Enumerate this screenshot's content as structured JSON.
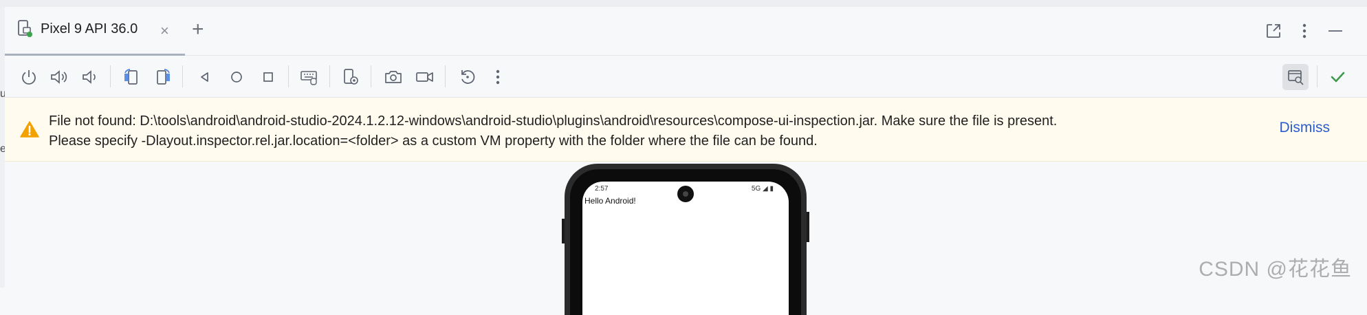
{
  "tab": {
    "title": "Pixel 9 API 36.0",
    "close_glyph": "×",
    "add_glyph": "+"
  },
  "window_controls": [
    "open-in-new-window-icon",
    "more-vertical-icon",
    "minimize-icon"
  ],
  "toolbar": {
    "buttons": [
      {
        "name": "power-icon",
        "tooltip": "Power"
      },
      {
        "name": "volume-up-icon",
        "tooltip": "Volume Up"
      },
      {
        "name": "volume-down-icon",
        "tooltip": "Volume Down"
      },
      {
        "name": "rotate-left-icon",
        "tooltip": "Rotate Left"
      },
      {
        "name": "rotate-right-icon",
        "tooltip": "Rotate Right"
      },
      {
        "name": "back-icon",
        "tooltip": "Back"
      },
      {
        "name": "home-icon",
        "tooltip": "Home"
      },
      {
        "name": "overview-icon",
        "tooltip": "Overview"
      },
      {
        "name": "keyboard-icon",
        "tooltip": "Keyboard"
      },
      {
        "name": "device-settings-icon",
        "tooltip": "Device Settings"
      },
      {
        "name": "camera-icon",
        "tooltip": "Take Screenshot"
      },
      {
        "name": "record-video-icon",
        "tooltip": "Record Screen"
      },
      {
        "name": "reset-icon",
        "tooltip": "Reset"
      },
      {
        "name": "more-vertical-icon",
        "tooltip": "More"
      },
      {
        "name": "layout-inspector-icon",
        "tooltip": "Layout Inspector"
      },
      {
        "name": "checkmark-icon",
        "tooltip": "Done"
      }
    ]
  },
  "banner": {
    "line1": "File not found: D:\\tools\\android\\android-studio-2024.1.2.12-windows\\android-studio\\plugins\\android\\resources\\compose-ui-inspection.jar. Make sure the file is present.",
    "line2": "Please specify -Dlayout.inspector.rel.jar.location=<folder> as a custom VM property with the folder where the file can be found.",
    "dismiss": "Dismiss"
  },
  "device": {
    "time": "2:57",
    "status": "5G ◢ ▮",
    "content": "Hello Android!"
  },
  "watermark": "CSDN @花花鱼",
  "left_edge_glyphs": [
    "u",
    "e"
  ],
  "colors": {
    "accent": "#2a5ccf",
    "warning": "#f2a100",
    "check": "#3c9a4b",
    "banner_bg": "#fffbee"
  }
}
